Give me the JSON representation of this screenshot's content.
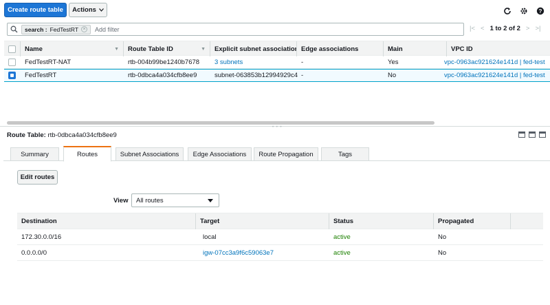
{
  "toolbar": {
    "create_label": "Create route table",
    "actions_label": "Actions"
  },
  "top_icons": [
    "refresh-icon",
    "gear-icon",
    "help-icon"
  ],
  "search": {
    "token_key": "search :",
    "token_value": "FedTestRT",
    "placeholder": "Add filter"
  },
  "pager": {
    "count": "1 to 2 of 2"
  },
  "table": {
    "headers": [
      "Name",
      "Route Table ID",
      "Explicit subnet association",
      "Edge associations",
      "Main",
      "VPC ID"
    ],
    "rows": [
      {
        "name": "FedTestRT-NAT",
        "id": "rtb-004b99be1240b7678",
        "subnet": "3 subnets",
        "edge": "-",
        "main": "Yes",
        "vpc": "vpc-0963ac921624e141d | fed-test",
        "selected": false
      },
      {
        "name": "FedTestRT",
        "id": "rtb-0dbca4a034cfb8ee9",
        "subnet": "subnet-063853b12994929c4",
        "edge": "-",
        "main": "No",
        "vpc": "vpc-0963ac921624e141d | fed-test",
        "selected": true
      }
    ]
  },
  "detail": {
    "label": "Route Table:",
    "value": "rtb-0dbca4a034cfb8ee9",
    "tabs": [
      "Summary",
      "Routes",
      "Subnet Associations",
      "Edge Associations",
      "Route Propagation",
      "Tags"
    ],
    "active_tab": "Routes",
    "edit_label": "Edit routes",
    "view_label": "View",
    "view_value": "All routes",
    "route_headers": [
      "Destination",
      "Target",
      "Status",
      "Propagated"
    ],
    "routes": [
      {
        "destination": "172.30.0.0/16",
        "target": "local",
        "status": "active",
        "propagated": "No"
      },
      {
        "destination": "0.0.0.0/0",
        "target": "igw-07cc3a9f6c59063e7",
        "status": "active",
        "propagated": "No"
      }
    ]
  },
  "colors": {
    "primary": "#1d76d6",
    "link": "#0073bb",
    "active": "#1d8102",
    "tab_accent": "#ec7211"
  }
}
